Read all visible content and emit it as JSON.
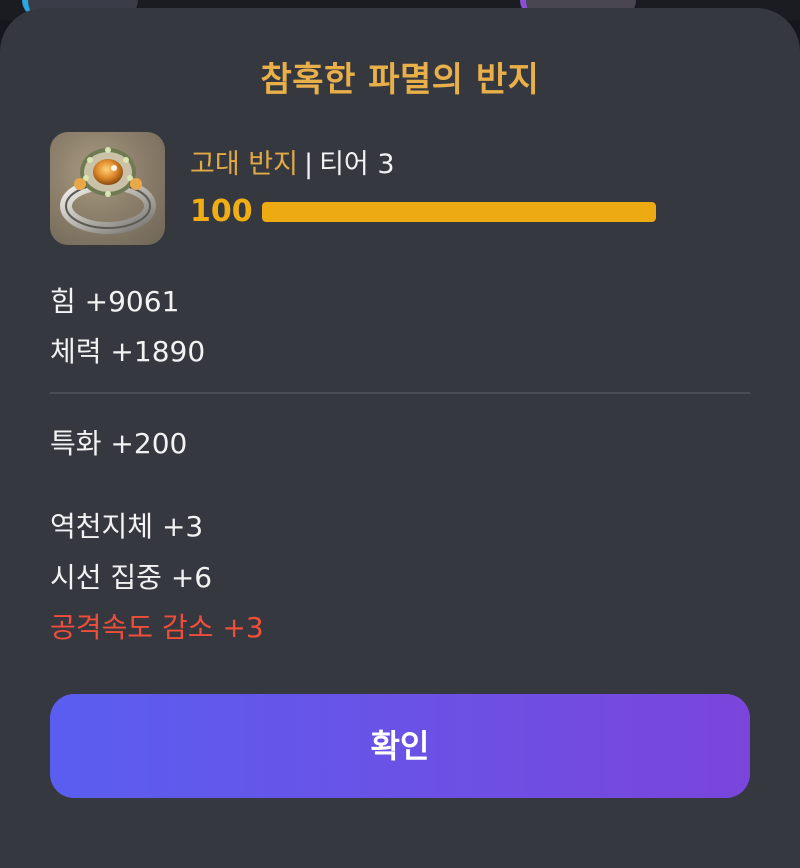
{
  "item": {
    "name": "참혹한 파멸의 반지",
    "type": "고대 반지",
    "separator": "|",
    "tier": "티어 3",
    "quality": 100,
    "icon": "ring-icon"
  },
  "base_stats": [
    {
      "label": "힘 +9061"
    },
    {
      "label": "체력 +1890"
    }
  ],
  "extra_stats": [
    {
      "label": "특화 +200"
    }
  ],
  "engravings": [
    {
      "label": "역천지체 +3",
      "negative": false
    },
    {
      "label": "시선 집중 +6",
      "negative": false
    },
    {
      "label": "공격속도 감소 +3",
      "negative": true
    }
  ],
  "actions": {
    "confirm_label": "확인"
  },
  "colors": {
    "accent_gold": "#e9b04a",
    "quality_bar": "#eeaa12",
    "negative_red": "#f04e3a",
    "button_gradient_start": "#5a5ef0",
    "button_gradient_end": "#7a45dc"
  }
}
